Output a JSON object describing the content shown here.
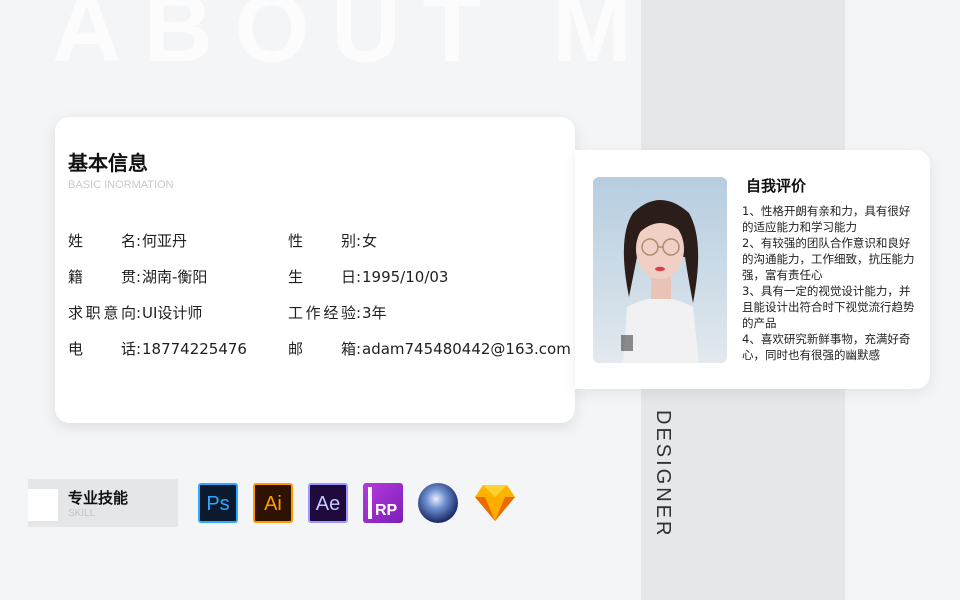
{
  "background": {
    "big_word": "ABOUT ME",
    "side_word": "DESIGNER"
  },
  "basic_info": {
    "title": "基本信息",
    "subtitle": "BASIC INORMATION",
    "fields": [
      {
        "label": "姓名",
        "value": "何亚丹"
      },
      {
        "label": "性别",
        "value": "女"
      },
      {
        "label": "籍贯",
        "value": "湖南-衡阳"
      },
      {
        "label": "生日",
        "value": "1995/10/03"
      },
      {
        "label": "求职意向",
        "value": "UI设计师"
      },
      {
        "label": "工作经验",
        "value": "3年"
      },
      {
        "label": "电话",
        "value": "18774225476"
      },
      {
        "label": "邮箱",
        "value": "adam745480442@163.com"
      }
    ]
  },
  "self_eval": {
    "title": "自我评价",
    "items": [
      "1、性格开朗有亲和力，具有很好的适应能力和学习能力",
      "2、有较强的团队合作意识和良好的沟通能力，工作细致，抗压能力强，富有责任心",
      "3、具有一定的视觉设计能力，并且能设计出符合时下视觉流行趋势的产品",
      "4、喜欢研究新鲜事物，充满好奇心，同时也有很强的幽默感"
    ]
  },
  "skills": {
    "title": "专业技能",
    "subtitle": "SKILL",
    "icons": [
      {
        "name": "photoshop-icon",
        "text": "Ps"
      },
      {
        "name": "illustrator-icon",
        "text": "Ai"
      },
      {
        "name": "after-effects-icon",
        "text": "Ae"
      },
      {
        "name": "axure-rp-icon",
        "text": "RP"
      },
      {
        "name": "cinema4d-icon",
        "text": ""
      },
      {
        "name": "sketch-icon",
        "text": ""
      }
    ]
  },
  "colors": {
    "ps": "#31a8ff",
    "ai": "#ff9a00",
    "ae": "#9999ff",
    "rp": "#b83ae0"
  }
}
